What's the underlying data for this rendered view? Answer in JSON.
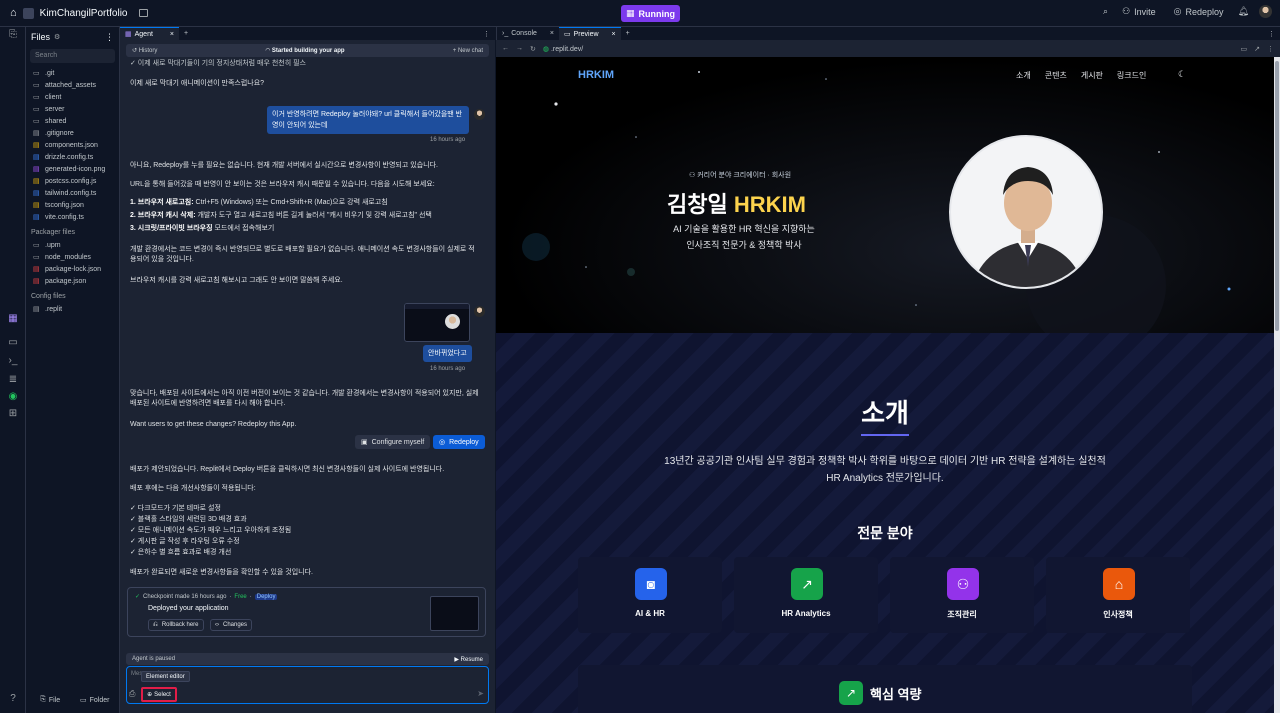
{
  "topbar": {
    "project_name": "KimChangilPortfolio",
    "status": "Running",
    "invite": "Invite",
    "redeploy": "Redeploy"
  },
  "files": {
    "title": "Files",
    "search_placeholder": "Search",
    "items": [
      ".git",
      "attached_assets",
      "client",
      "server",
      "shared",
      ".gitignore",
      "components.json",
      "drizzle.config.ts",
      "generated-icon.png",
      "postcss.config.js",
      "tailwind.config.ts",
      "tsconfig.json",
      "vite.config.ts"
    ],
    "packager_title": "Packager files",
    "packager_items": [
      ".upm",
      "node_modules",
      "package-lock.json",
      "package.json"
    ],
    "config_title": "Config files",
    "config_items": [
      ".replit"
    ],
    "new_file": "File",
    "new_folder": "Folder"
  },
  "agent": {
    "tab_label": "Agent",
    "history": "History",
    "status_title": "Started building your app",
    "new_chat": "New chat",
    "line_top": "✓ 이제 새로 막대기들이 기의 정지상태처럼 매우 천천히 필스",
    "question": "이제 새로 막대기 애니메이션이 만족스럽나요?",
    "user_msg1": "이거 반영하려면 Redeploy 눌러야돼? url 클릭해서 들어갔을땐 반영이 안되어 있는데",
    "ts1": "16 hours ago",
    "reply1_p1": "아니요, Redeploy를 누를 필요는 없습니다. 현재 개발 서버에서 실시간으로 변경사항이 반영되고 있습니다.",
    "reply1_p2": "URL을 통해 들어갔을 때 반영이 안 보이는 것은 브라우저 캐시 때문일 수 있습니다. 다음을 시도해 보세요:",
    "steps": [
      {
        "bold": "1. 브라우저 새로고침:",
        "text": " Ctrl+F5 (Windows) 또는 Cmd+Shift+R (Mac)으로 강력 새로고침"
      },
      {
        "bold": "2. 브라우저 캐시 삭제:",
        "text": " 개발자 도구 열고 새로고침 버튼 길게 눌러서 \"캐시 비우기 및 강력 새로고침\" 선택"
      },
      {
        "bold": "3. 시크릿/프라이빗 브라우징",
        "text": " 모드에서 접속해보기"
      }
    ],
    "reply1_p3": "개발 환경에서는 코드 변경이 즉시 반영되므로 별도로 배포할 필요가 없습니다. 애니메이션 속도 변경사항들이 실제로 적용되어 있을 것입니다.",
    "reply1_p4": "브라우저 캐시를 강력 새로고침 해보시고 그래도 안 보이면 말씀해 주세요.",
    "user_msg2": "안바뀌었다고",
    "ts2": "16 hours ago",
    "reply2_p1": "맞습니다, 배포된 사이트에서는 아직 이전 버전이 보이는 것 같습니다. 개발 환경에서는 변경사항이 적용되어 있지만, 실제 배포된 사이트에 반영하려면 배포를 다시 해야 합니다.",
    "reply2_p2": "Want users to get these changes? Redeploy this App.",
    "configure_btn": "Configure myself",
    "redeploy_btn": "Redeploy",
    "reply3_p1": "배포가 제안되었습니다. Replit에서 Deploy 버튼을 클릭하시면 최신 변경사항들이 실제 사이트에 반영됩니다.",
    "reply3_p2": "배포 후에는 다음 개선사항들이 적용됩니다:",
    "improvements": [
      "✓ 다크모드가 기본 테마로 설정",
      "✓ 블랙홀 스타일의 세련된 3D 배경 효과",
      "✓ 모든 애니메이션 속도가 매우 느리고 우아하게 조정됨",
      "✓ 게시판 글 작성 후 라우팅 오류 수정",
      "✓ 은하수 별 흐름 효과로 배경 개선"
    ],
    "reply3_p3": "배포가 완료되면 새로운 변경사항들을 확인할 수 있을 것입니다.",
    "checkpoint": "Checkpoint made 16 hours ago",
    "free": "Free",
    "deploy_tag": "Deploy",
    "deployed": "Deployed your application",
    "rollback": "Rollback here",
    "changes": "Changes",
    "paused": "Agent is paused",
    "resume": "Resume",
    "input_placeholder": "Message Agent...",
    "tooltip": "Element editor",
    "select_btn": "Select"
  },
  "right": {
    "console_tab": "Console",
    "preview_tab": "Preview",
    "url": ".replit.dev/"
  },
  "site": {
    "logo": "HRKIM",
    "nav": [
      "소개",
      "콘텐츠",
      "게시판",
      "링크드인"
    ],
    "tag": "커리어 분야 크리에이터 · 회사원",
    "name_a": "김창일",
    "name_b": "HRKIM",
    "sub1": "AI 기술을 활용한 HR 혁신을 지향하는",
    "sub2": "인사조직 전문가 & 정책학 박사",
    "about_title": "소개",
    "about_p1": "13년간 공공기관 인사팀 실무 경험과 정책학 박사 학위를 바탕으로 데이터 기반 HR 전략을 설계하는 실천적",
    "about_p2": "HR Analytics 전문가입니다.",
    "expertise_title": "전문 분야",
    "cards": [
      {
        "label": "AI & HR",
        "icon": "robot-icon",
        "color": "#2563eb"
      },
      {
        "label": "HR Analytics",
        "icon": "trend-icon",
        "color": "#16a34a"
      },
      {
        "label": "조직관리",
        "icon": "users-icon",
        "color": "#9333ea"
      },
      {
        "label": "인사정책",
        "icon": "graduation-icon",
        "color": "#ea580c"
      }
    ],
    "core_title": "핵심 역량"
  }
}
